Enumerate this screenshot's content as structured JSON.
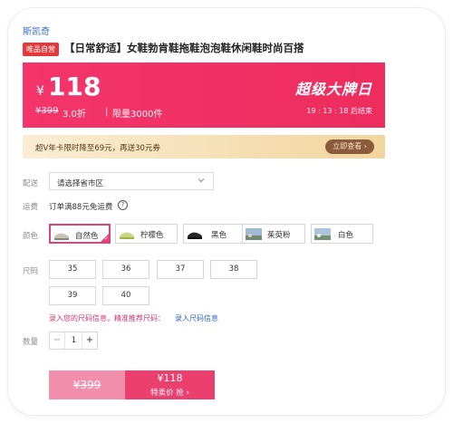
{
  "brand": "斯凯奇",
  "product": {
    "tag": "唯品自营",
    "title": "【日常舒适】女鞋勃肯鞋拖鞋泡泡鞋休闲鞋时尚百搭"
  },
  "price_bar": {
    "currency": "¥",
    "price": "118",
    "original": "¥399",
    "discount": "3.0折",
    "separator": "|",
    "limit": "限量3000件",
    "event_name": "超级大牌日",
    "countdown": "19 : 13 : 18  后结束"
  },
  "coupon": {
    "text": "超V年卡限时降至69元，再送30元券",
    "button": "立即查看 ›"
  },
  "delivery": {
    "label": "配送",
    "placeholder": "请选择省市区",
    "chevron_icon": "chevron-down-icon"
  },
  "shipping": {
    "label": "运费",
    "text": "订单满88元免运费",
    "help_icon": "?"
  },
  "colors": {
    "label": "颜色",
    "selected": "自然色",
    "options": [
      {
        "label": "自然色",
        "swatch": "#c8c2b6"
      },
      {
        "label": "柠檬色",
        "swatch": "#c7d97b"
      },
      {
        "label": "黑色",
        "swatch": "#262626"
      },
      {
        "label": "茱萸粉",
        "swatch": "#9fbad5"
      },
      {
        "label": "白色",
        "swatch": "#a9c4dc"
      }
    ]
  },
  "sizes": {
    "label": "尺码",
    "options": [
      "35",
      "36",
      "37",
      "38",
      "39",
      "40"
    ]
  },
  "size_hint": {
    "text": "录入您的尺码信息，精准推荐尺码：",
    "link": "录入尺码信息"
  },
  "quantity": {
    "label": "数量",
    "value": "1",
    "minus": "−",
    "plus": "+"
  },
  "buy": {
    "original": "¥399",
    "price": "¥118",
    "cta": "特卖价 抢 ›"
  },
  "accent": "#ee2c5e"
}
